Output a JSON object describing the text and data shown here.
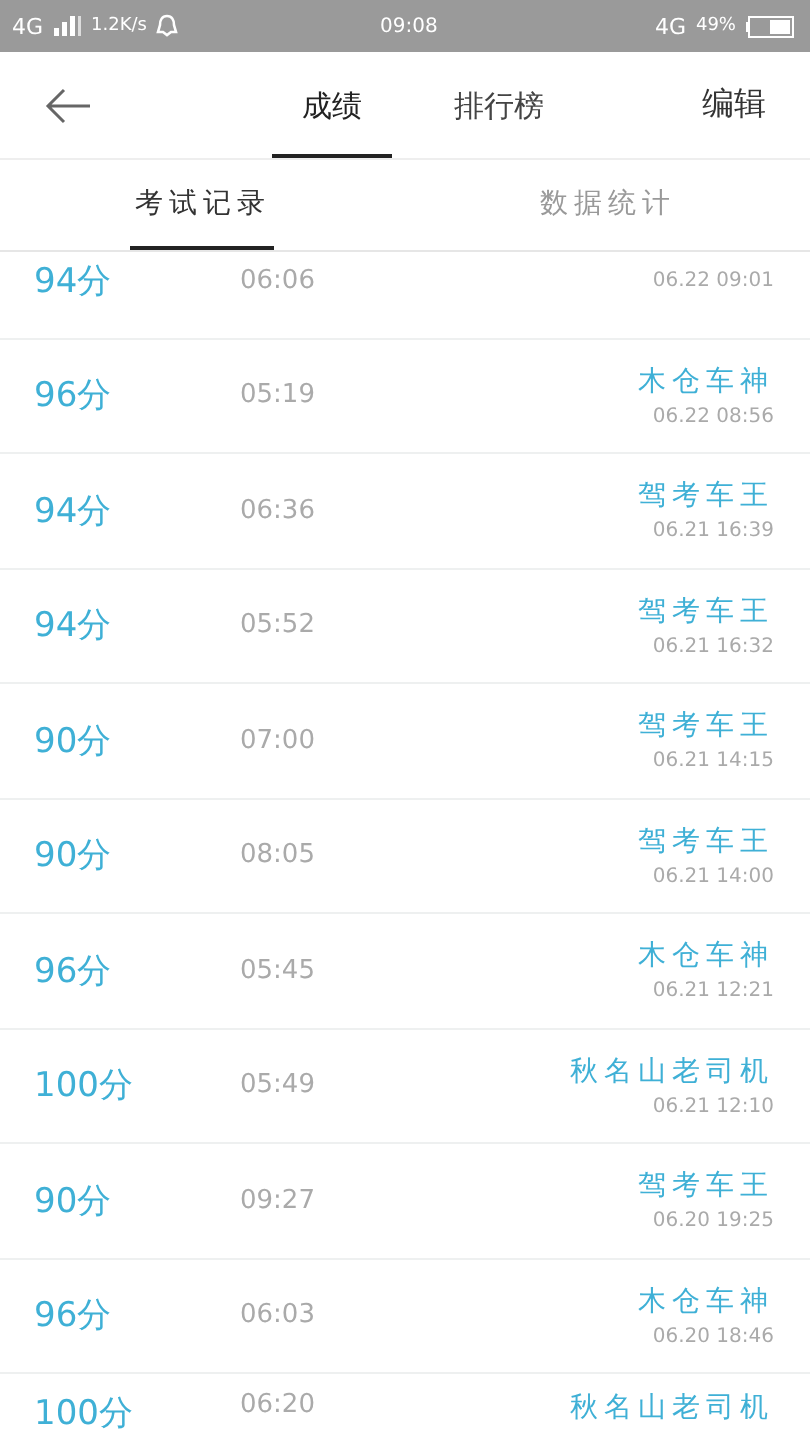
{
  "status_bar": {
    "network": "4G",
    "speed": "1.2K/s",
    "time": "09:08",
    "network_right": "4G",
    "battery": "49%"
  },
  "header": {
    "tabs": [
      {
        "label": "成绩",
        "selected": true
      },
      {
        "label": "排行榜",
        "selected": false
      }
    ],
    "action": "编辑"
  },
  "subtabs": [
    {
      "label": "考试记录",
      "selected": true
    },
    {
      "label": "数据统计",
      "selected": false
    }
  ],
  "records": [
    {
      "score": "94分",
      "duration": "06:06",
      "date": "06.22 09:01"
    },
    {
      "score": "96分",
      "duration": "05:19",
      "name": "木仓车神",
      "date": "06.22 08:56"
    },
    {
      "score": "94分",
      "duration": "06:36",
      "name": "驾考车王",
      "date": "06.21 16:39"
    },
    {
      "score": "94分",
      "duration": "05:52",
      "name": "驾考车王",
      "date": "06.21 16:32"
    },
    {
      "score": "90分",
      "duration": "07:00",
      "name": "驾考车王",
      "date": "06.21 14:15"
    },
    {
      "score": "90分",
      "duration": "08:05",
      "name": "驾考车王",
      "date": "06.21 14:00"
    },
    {
      "score": "96分",
      "duration": "05:45",
      "name": "木仓车神",
      "date": "06.21 12:21"
    },
    {
      "score": "100分",
      "duration": "05:49",
      "name": "秋名山老司机",
      "date": "06.21 12:10"
    },
    {
      "score": "90分",
      "duration": "09:27",
      "name": "驾考车王",
      "date": "06.20 19:25"
    },
    {
      "score": "96分",
      "duration": "06:03",
      "name": "木仓车神",
      "date": "06.20 18:46"
    },
    {
      "score": "100分",
      "duration": "06:20",
      "name": "秋名山老司机"
    }
  ]
}
